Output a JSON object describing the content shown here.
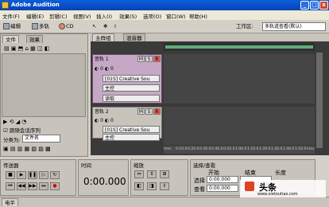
{
  "app": {
    "title": "Adobe Audition"
  },
  "menu": [
    "文件(F)",
    "编辑(E)",
    "剪辑(C)",
    "视图(V)",
    "插入(I)",
    "效果(S)",
    "选项(O)",
    "窗口(W)",
    "帮助(H)"
  ],
  "toolbar": {
    "edit": "编辑",
    "multitrack": "多轨",
    "cd": "CD",
    "workspace_label": "工作区:",
    "workspace_value": "多轨道查看(默认)"
  },
  "left_tabs": [
    "文件",
    "效果"
  ],
  "files": {
    "snap_label": "跟随会话序列",
    "sort_label": "分类为:",
    "sort_value": "文件名"
  },
  "editor_tabs": [
    "主群组",
    "混音器"
  ],
  "tracks": [
    {
      "name": "音轨 1",
      "input": "[01S] Creative Sou",
      "output": "主控",
      "mode": "读取"
    },
    {
      "name": "音轨 2",
      "input": "[01S] Creative Sou",
      "output": "主控"
    }
  ],
  "msr": [
    "M",
    "S",
    "R"
  ],
  "ruler": [
    "hms",
    "0:10.0",
    "0:20.0",
    "0:30.0",
    "0:40.0",
    "0:50.0",
    "1:00.0",
    "1:10.0",
    "1:20.0",
    "1:30.0",
    "1:40.0",
    "1:50.0",
    "hms"
  ],
  "panels": {
    "transport": "传送器",
    "time": "时间",
    "time_value": "0:00.000",
    "zoom": "缩放",
    "selection": "选择/查看",
    "level": "电平"
  },
  "selection": {
    "headers": [
      "开始",
      "结束",
      "长度"
    ],
    "rows": [
      {
        "label": "选择",
        "start": "0:00.000"
      },
      {
        "label": "查看",
        "start": "0:00.000"
      }
    ]
  },
  "watermark": "头条",
  "watermark_url": "www.xietoutiao.com"
}
